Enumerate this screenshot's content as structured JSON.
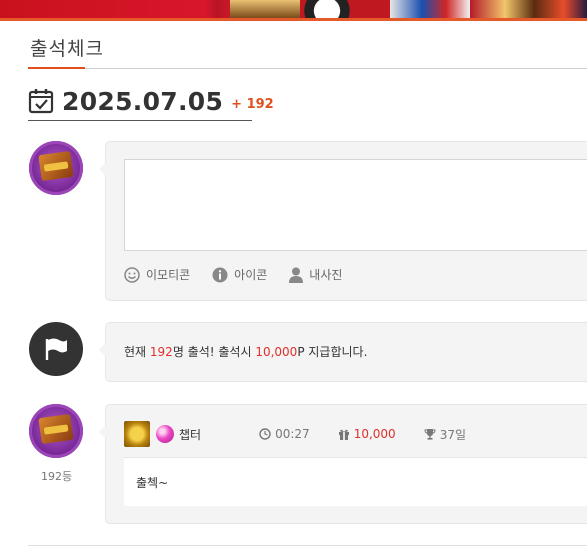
{
  "section": {
    "title": "출석체크"
  },
  "date": {
    "value": "2025.07.05",
    "count": "+ 192"
  },
  "write": {
    "tools": [
      {
        "icon": "smiley-icon",
        "label": "이모티콘"
      },
      {
        "icon": "info-icon",
        "label": "아이콘"
      },
      {
        "icon": "person-icon",
        "label": "내사진"
      }
    ]
  },
  "notice": {
    "prefix": "현재 ",
    "count": "192",
    "middle": "명 출석! 출석시 ",
    "points": "10,000",
    "suffix": "P 지급합니다."
  },
  "entry": {
    "rank": "192등",
    "nickname": "챕터",
    "time": "00:27",
    "points": "10,000",
    "days": "37일",
    "text": "출첵~"
  },
  "colors": {
    "accent": "#e0501e",
    "highlight": "#e0302a"
  }
}
